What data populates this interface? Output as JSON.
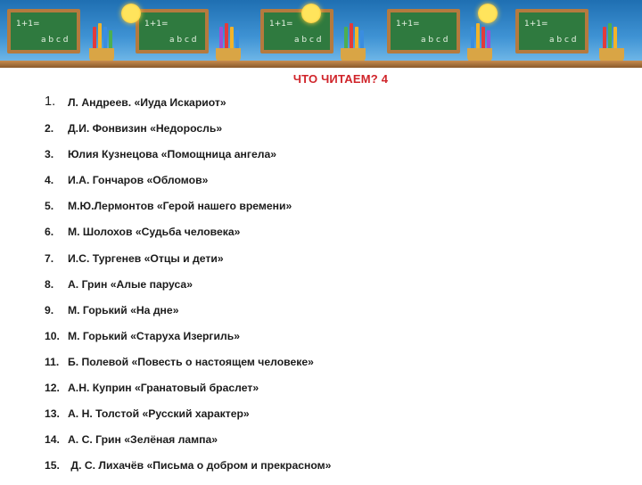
{
  "header": {
    "title": "ЧТО ЧИТАЕМ? 4",
    "boards": [
      {
        "chalk_top": "1+1=",
        "chalk_bottom": "a b c d"
      },
      {
        "chalk_top": "1+1=",
        "chalk_bottom": "a b c d"
      },
      {
        "chalk_top": "1+1=",
        "chalk_bottom": "a b c d"
      },
      {
        "chalk_top": "1+1=",
        "chalk_bottom": "a b c d"
      },
      {
        "chalk_top": "1+1=",
        "chalk_bottom": "a b c d"
      }
    ]
  },
  "colors": {
    "title": "#d0242a",
    "text": "#1c1c1c",
    "sky": "#3f93d4",
    "board": "#2f7a3f",
    "frame": "#b57a3e"
  },
  "reading_list": [
    {
      "number": "1.",
      "text": "Л. Андреев. «Иуда Искариот»"
    },
    {
      "number": "2.",
      "text": "Д.И. Фонвизин «Недоросль»"
    },
    {
      "number": "3.",
      "text": "Юлия Кузнецова «Помощница ангела»"
    },
    {
      "number": "4.",
      "text": "И.А. Гончаров «Обломов»"
    },
    {
      "number": "5.",
      "text": "М.Ю.Лермонтов «Герой нашего времени»"
    },
    {
      "number": "6.",
      "text": "М. Шолохов «Судьба человека»"
    },
    {
      "number": "7.",
      "text": "И.С. Тургенев «Отцы и дети»"
    },
    {
      "number": "8.",
      "text": "А. Грин «Алые паруса»"
    },
    {
      "number": "9.",
      "text": "М. Горький «На дне»"
    },
    {
      "number": "10.",
      "text": "М. Горький «Старуха Изергиль»"
    },
    {
      "number": "11.",
      "text": "Б. Полевой «Повесть о настоящем человеке»"
    },
    {
      "number": "12.",
      "text": "А.Н. Куприн «Гранатовый браслет»"
    },
    {
      "number": "13.",
      "text": "А. Н. Толстой «Русский характер»"
    },
    {
      "number": "14.",
      "text": "А. С.  Грин «Зелёная лампа»"
    },
    {
      "number": "15.",
      "text": " Д. С. Лихачёв «Письма о добром и прекрасном»"
    }
  ]
}
